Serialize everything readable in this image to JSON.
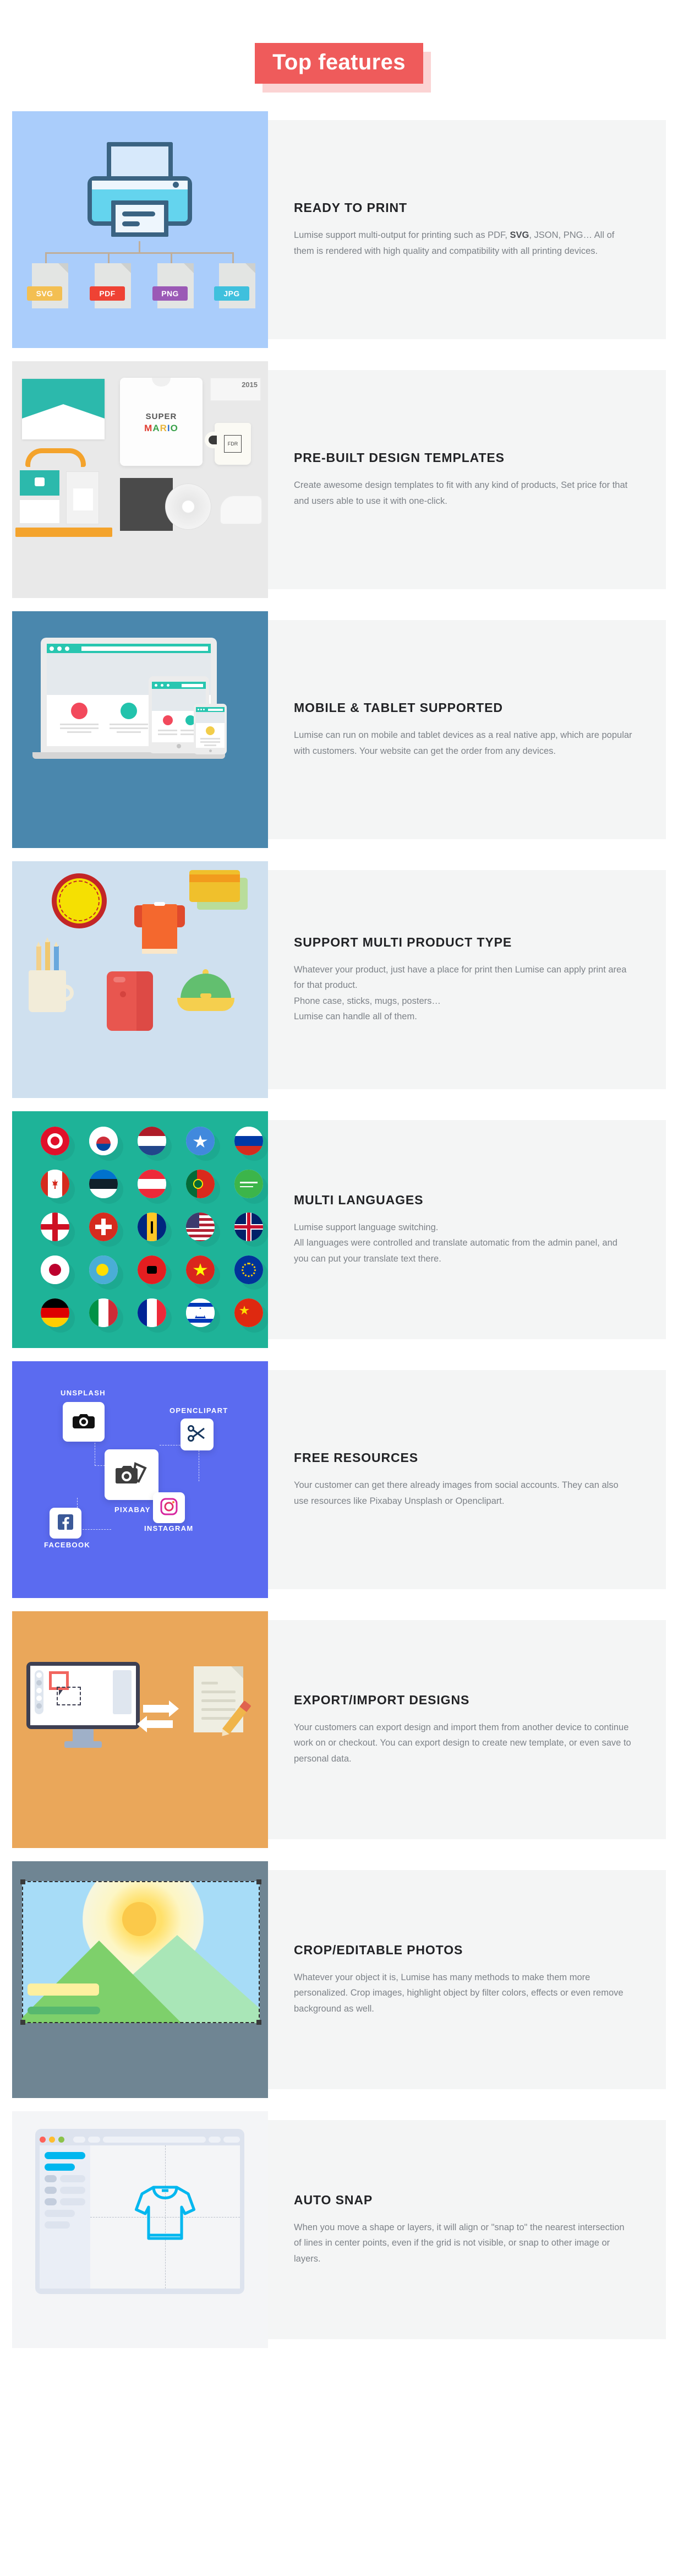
{
  "header": {
    "title": "Top features"
  },
  "features": [
    {
      "id": "ready-to-print",
      "title": "READY TO PRINT",
      "body_before": "Lumise support multi-output for printing such as PDF, ",
      "body_bold": "SVG",
      "body_after": ", JSON, PNG… All of them is rendered with high quality and compatibility with all printing devices.",
      "art": {
        "kind": "printer-formats",
        "bg": "#aacdfb",
        "formats": [
          {
            "label": "SVG",
            "color": "#f3bf52"
          },
          {
            "label": "PDF",
            "color": "#ef4234"
          },
          {
            "label": "PNG",
            "color": "#9b59b6"
          },
          {
            "label": "JPG",
            "color": "#3fc0dd"
          }
        ]
      }
    },
    {
      "id": "pre-built-design-templates",
      "title": "PRE-BUILT DESIGN TEMPLATES",
      "body": "Create awesome design templates to fit with any kind of products, Set price for that and users able to use it with one-click.",
      "art": {
        "kind": "branding-mockup",
        "bg": "#e9e9e9",
        "tshirt_line1": "SUPER",
        "tshirt_line2": "MARIO",
        "ticket_year": "2015",
        "mug_monogram": "FDR"
      }
    },
    {
      "id": "mobile-tablet-supported",
      "title": "MOBILE & TABLET SUPPORTED",
      "body": "Lumise can run on mobile and tablet devices as a real native app, which are popular with customers. Your website can get the order from any devices.",
      "art": {
        "kind": "responsive-devices",
        "bg": "#4a87ad",
        "accent": "#28c6b0",
        "dots": [
          "#f2495c",
          "#22c3ac",
          "#f2cd4a"
        ]
      }
    },
    {
      "id": "support-multi-product-type",
      "title": "SUPPORT MULTI PRODUCT TYPE",
      "body": "Whatever your product, just have a place for print then Lumise can apply print area for that product.\nPhone case, sticks, mugs, posters…\nLumise can handle all of them.",
      "art": {
        "kind": "product-icons",
        "bg": "#cfe0ef",
        "items": [
          "badge-pin",
          "t-shirt",
          "credit-card",
          "mug-with-pencils",
          "phone-case",
          "baseball-cap"
        ]
      }
    },
    {
      "id": "multi-languages",
      "title": "MULTI LANGUAGES",
      "body": "Lumise support language switching.\nAll languages were controlled and translate automatic from the admin panel, and you can put your translate text there.",
      "art": {
        "kind": "flag-grid",
        "bg": "#1eb398",
        "rows": 5,
        "cols": 5,
        "flags": [
          "Tunisia",
          "South Korea",
          "Netherlands",
          "Somalia",
          "Russia",
          "Canada",
          "Estonia",
          "Austria",
          "Portugal",
          "Saudi Arabia",
          "England",
          "Switzerland",
          "Barbados",
          "United States",
          "United Kingdom",
          "Japan",
          "Palau",
          "Albania",
          "Vietnam",
          "European Union",
          "Germany",
          "Italy",
          "France",
          "Israel",
          "China"
        ]
      }
    },
    {
      "id": "free-resources",
      "title": "FREE RESOURCES",
      "body": "Your customer can get there already images from social accounts. They can also use resources like Pixabay Unsplash or Openclipart.",
      "art": {
        "kind": "resource-network",
        "bg": "#5b6bf0",
        "nodes": [
          {
            "label": "UNSPLASH",
            "icon": "camera-icon"
          },
          {
            "label": "OPENCLIPART",
            "icon": "scissors-icon"
          },
          {
            "label": "PIXABAY",
            "icon": "camera-photos-icon"
          },
          {
            "label": "INSTAGRAM",
            "icon": "instagram-icon"
          },
          {
            "label": "FACEBOOK",
            "icon": "facebook-icon"
          }
        ]
      }
    },
    {
      "id": "export-import-designs",
      "title": "EXPORT/IMPORT DESIGNS",
      "body": "Your customers can export design and import them from another device to continue work on or checkout. You can export design to create new template, or even save to personal data.",
      "art": {
        "kind": "export-import",
        "bg": "#eaa75a",
        "selection_color": "#f1655f"
      }
    },
    {
      "id": "crop-editable-photos",
      "title": "CROP/EDITABLE PHOTOS",
      "body": "Whatever your object it is, Lumise has many methods to make them more personalized. Crop images, highlight object by filter colors, effects or even remove background as well.",
      "art": {
        "kind": "crop-photo",
        "bg": "#6f8593"
      }
    },
    {
      "id": "auto-snap",
      "title": "AUTO SNAP",
      "body": "When you move a shape or layers, it will align or \"snap to\" the nearest intersection of lines in center points, even if the grid is not visible, or snap to other image or layers.",
      "art": {
        "kind": "snap-editor",
        "bg": "#f4f5f7",
        "accent": "#00b7ef",
        "window_dots": [
          "#ff6159",
          "#ffbd2e",
          "#8bc34a"
        ]
      }
    }
  ]
}
